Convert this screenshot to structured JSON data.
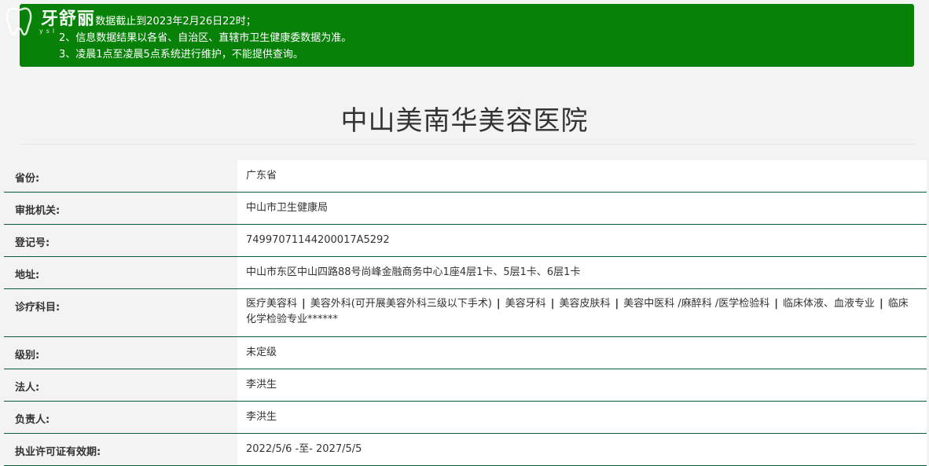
{
  "watermark": {
    "brand": "牙舒丽",
    "sub": "ysl"
  },
  "notice": {
    "lines": [
      "1、数据截止到2023年2月26日22时；",
      "2、信息数据结果以各省、自治区、直辖市卫生健康委数据为准。",
      "3、凌晨1点至凌晨5点系统进行维护，不能提供查询。"
    ],
    "color": "#078107"
  },
  "hospital": {
    "name": "中山美南华美容医院"
  },
  "rows": [
    {
      "label": "省份:",
      "value": "广东省"
    },
    {
      "label": "审批机关:",
      "value": "中山市卫生健康局"
    },
    {
      "label": "登记号:",
      "value": "74997071144200017A5292"
    },
    {
      "label": "地址:",
      "value": "中山市东区中山四路88号尚峰金融商务中心1座4层1卡、5层1卡、6层1卡"
    },
    {
      "label": "诊疗科目:",
      "departments": [
        "医疗美容科",
        "美容外科(可开展美容外科三级以下手术)",
        "美容牙科",
        "美容皮肤科",
        "美容中医科 /麻醉科 /医学检验科",
        "临床体液、血液专业",
        "临床化学检验专业******"
      ],
      "separator": "|"
    },
    {
      "label": "级别:",
      "value": "未定级"
    },
    {
      "label": "法人:",
      "value": "李洪生"
    },
    {
      "label": "负责人:",
      "value": "李洪生"
    },
    {
      "label": "执业许可证有效期:",
      "value": "2022/5/6 -至- 2027/5/5"
    }
  ],
  "colors": {
    "row_border": "#0b5d3a",
    "label_bg": "#f3f3f3",
    "value_bg": "#ffffff"
  }
}
